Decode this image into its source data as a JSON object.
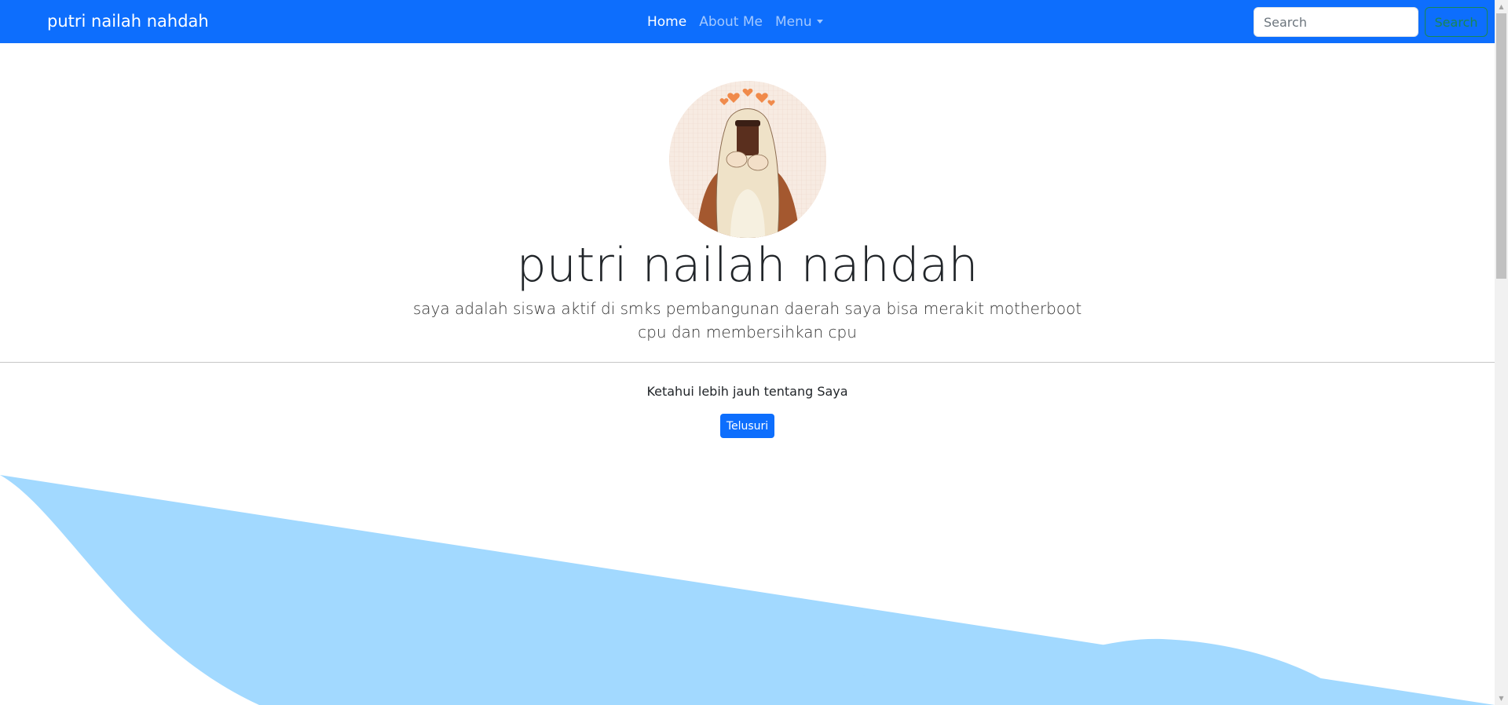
{
  "navbar": {
    "brand": "putri nailah nahdah",
    "links": [
      {
        "label": "Home",
        "active": true
      },
      {
        "label": "About Me",
        "active": false
      },
      {
        "label": "Menu",
        "active": false,
        "dropdown": true
      }
    ],
    "search": {
      "placeholder": "Search",
      "button_label": "Search"
    },
    "background_color": "#0d6efd"
  },
  "hero": {
    "avatar_icon": "hijab-girl-illustration",
    "title": "putri nailah nahdah",
    "lead": "saya adalah siswa aktif di smks pembangunan daerah saya bisa merakit motherboot cpu dan membersihkan cpu"
  },
  "section": {
    "text": "Ketahui lebih jauh tentang Saya",
    "button_label": "Telusuri",
    "button_color": "#0d6efd"
  },
  "wave": {
    "color": "#a2d9ff"
  }
}
